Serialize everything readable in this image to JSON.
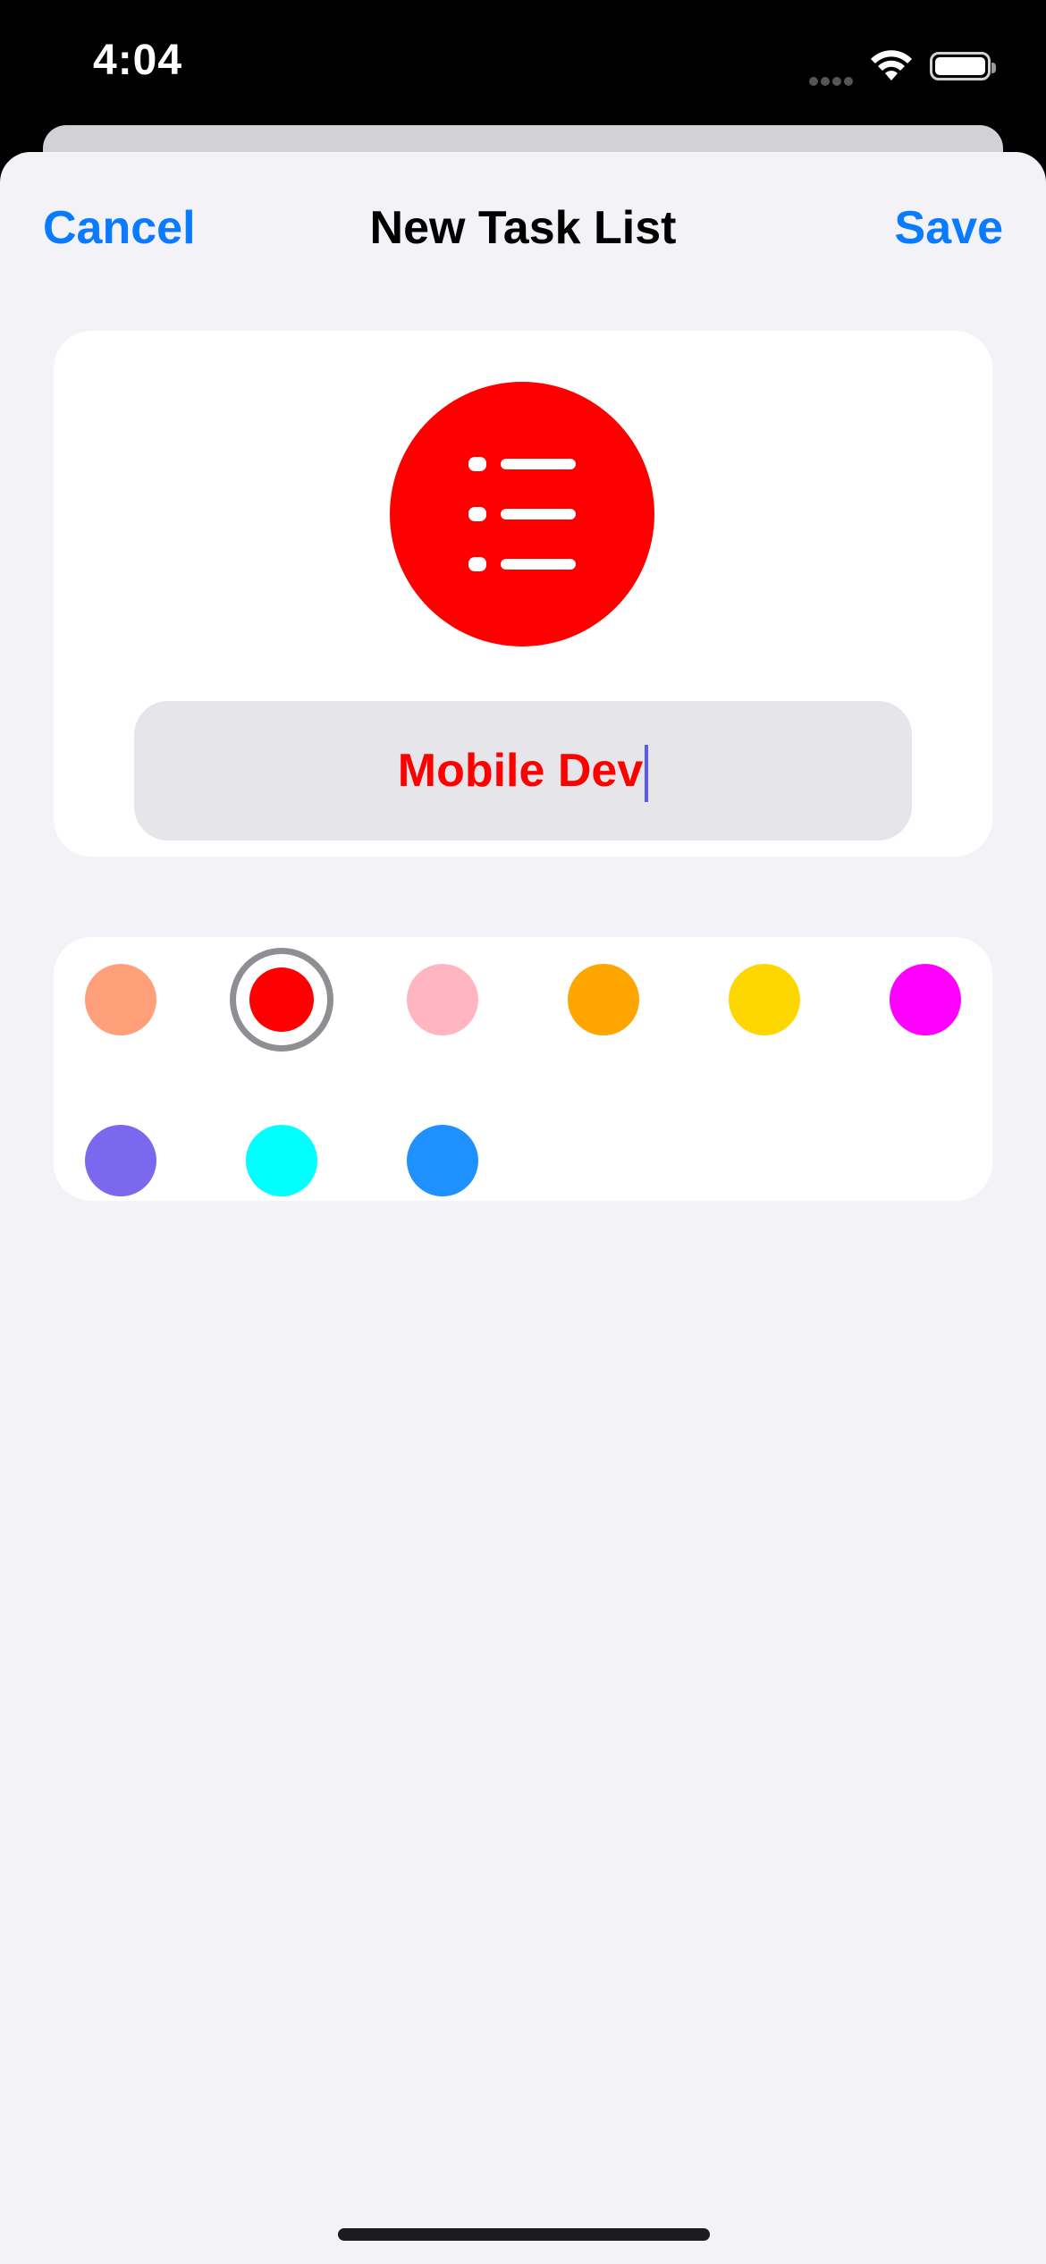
{
  "status": {
    "time": "4:04"
  },
  "nav": {
    "cancel_label": "Cancel",
    "title": "New Task List",
    "save_label": "Save"
  },
  "list": {
    "name": "Mobile Dev",
    "icon": "list-bullet-icon",
    "color": "#ff0000"
  },
  "colors": {
    "options": [
      "#ffa07a",
      "#ff0000",
      "#ffb6c1",
      "#ffa500",
      "#ffd700",
      "#ff00ff",
      "#7b68ee",
      "#00ffff",
      "#1e90ff"
    ],
    "selected_index": 1
  },
  "theme": {
    "accent": "#0a7aff",
    "background": "#f2f2f7"
  }
}
